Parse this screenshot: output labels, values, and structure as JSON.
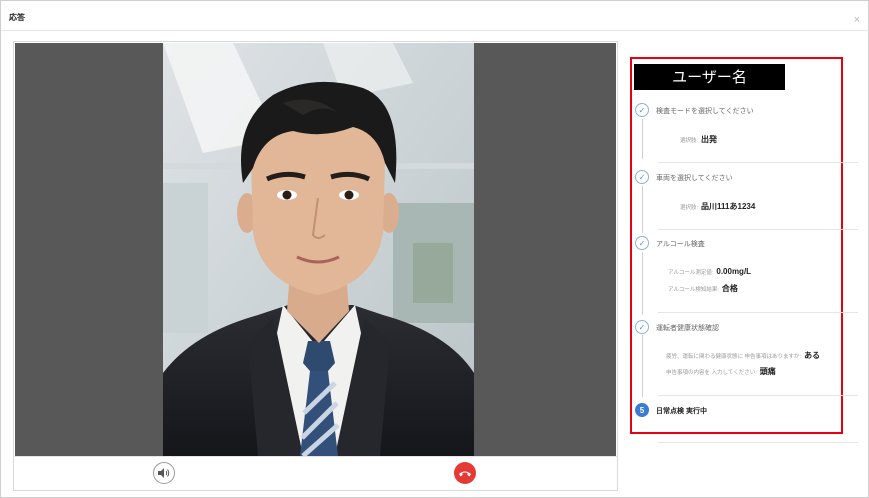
{
  "dialog": {
    "title": "応答",
    "close_glyph": "×"
  },
  "video": {
    "speaker_icon": "speaker-icon",
    "hangup_icon": "hangup-phone-icon"
  },
  "checklist": {
    "username": "ユーザー名",
    "steps": [
      {
        "title": "検査モードを選択してください",
        "fields": [
          {
            "label": "選択肢:",
            "value": "出発"
          }
        ]
      },
      {
        "title": "車両を選択してください",
        "fields": [
          {
            "label": "選択肢:",
            "value": "品川111あ1234"
          }
        ]
      },
      {
        "title": "アルコール検査",
        "fields": [
          {
            "label": "アルコール測定値:",
            "value": "0.00mg/L"
          },
          {
            "label": "アルコール検知結果:",
            "value": "合格"
          }
        ]
      },
      {
        "title": "運転者健康状態確認",
        "fields": [
          {
            "label": "疲労、運転に関わる健康状態に 申告事項はありますか:",
            "value": "ある"
          },
          {
            "label": "申告事項の内容を 入力してください:",
            "value": "頭痛"
          }
        ]
      },
      {
        "number": "5",
        "title": "日常点検 実行中"
      }
    ]
  },
  "colors": {
    "highlight_border": "#e60012",
    "active_step": "#3a7bd5",
    "hangup": "#e53935",
    "video_background": "#585858"
  }
}
